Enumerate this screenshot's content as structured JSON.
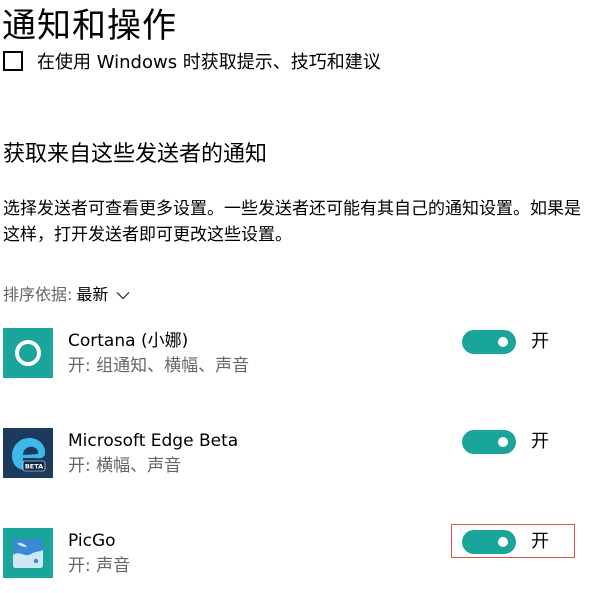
{
  "header": {
    "title": "通知和操作"
  },
  "tips_row": {
    "label": "在使用 Windows 时获取提示、技巧和建议"
  },
  "section": {
    "heading": "获取来自这些发送者的通知",
    "description": "选择发送者可查看更多设置。一些发送者还可能有其自己的通知设置。如果是这样，打开发送者即可更改这些设置。"
  },
  "sort": {
    "label": "排序依据:",
    "value": "最新",
    "chevron_icon": "chevron-down-icon"
  },
  "senders": [
    {
      "name": "Cortana (小娜)",
      "status": "开: 组通知、横幅、声音",
      "icon": "cortana-icon",
      "toggle_on": true,
      "toggle_label": "开",
      "icon_color": "#1aa59a"
    },
    {
      "name": "Microsoft Edge Beta",
      "status": "开: 横幅、声音",
      "icon": "edge-beta-icon",
      "icon_badge": "BETA",
      "toggle_on": true,
      "toggle_label": "开",
      "icon_color": "#1b3a5c"
    },
    {
      "name": "PicGo",
      "status": "开: 声音",
      "icon": "picgo-icon",
      "toggle_on": true,
      "toggle_label": "开",
      "icon_color": "#1aa59a",
      "highlighted": true
    }
  ],
  "colors": {
    "accent": "#1aa59a",
    "secondary_text": "#666666",
    "highlight_border": "#d9534f"
  }
}
